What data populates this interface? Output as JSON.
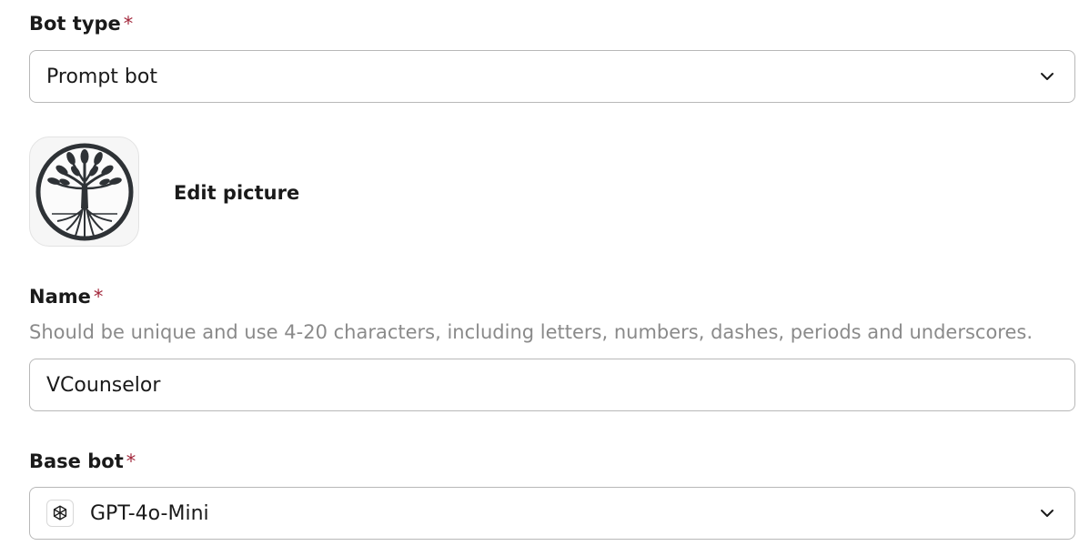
{
  "bot_type": {
    "label": "Bot type",
    "required_mark": "*",
    "selected": "Prompt bot"
  },
  "picture": {
    "edit_label": "Edit picture",
    "avatar_icon": "tree-of-life-icon"
  },
  "name": {
    "label": "Name",
    "required_mark": "*",
    "hint": "Should be unique and use 4-20 characters, including letters, numbers, dashes, periods and underscores.",
    "value": "VCounselor"
  },
  "base_bot": {
    "label": "Base bot",
    "required_mark": "*",
    "selected": "GPT-4o-Mini",
    "icon": "openai-icon"
  },
  "colors": {
    "required": "#a3283c",
    "hint": "#8a8a8a",
    "border": "#b8b8b8",
    "avatar_ink": "#2e3236"
  }
}
